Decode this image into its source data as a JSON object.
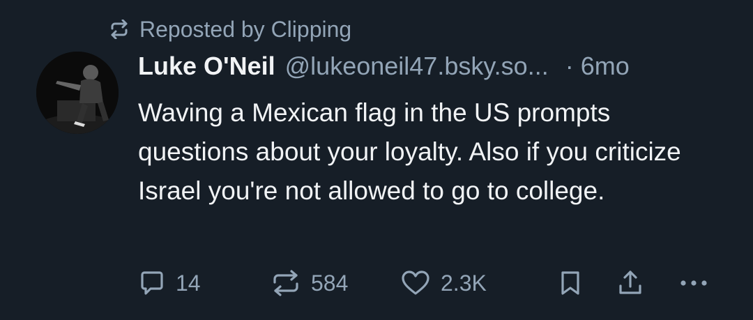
{
  "repost": {
    "label": "Reposted by Clipping",
    "icon": "repost-icon"
  },
  "author": {
    "display_name": "Luke O'Neil",
    "handle": "@lukeoneil47.bsky.so...",
    "separator": "·",
    "time": "6mo",
    "avatar_icon": "avatar-photo"
  },
  "post": {
    "text": "Waving a Mexican flag in the US prompts questions about your loyalty. Also if you criticize Israel you're not allowed to go to college."
  },
  "actions": {
    "reply": {
      "icon": "reply-icon",
      "count": "14"
    },
    "repost": {
      "icon": "repost-icon",
      "count": "584"
    },
    "like": {
      "icon": "heart-icon",
      "count": "2.3K"
    },
    "bookmark": {
      "icon": "bookmark-icon"
    },
    "share": {
      "icon": "share-icon"
    },
    "more": {
      "icon": "more-icon"
    }
  },
  "colors": {
    "background": "#161e27",
    "text": "#f1f3f5",
    "muted": "#93a5b7"
  }
}
